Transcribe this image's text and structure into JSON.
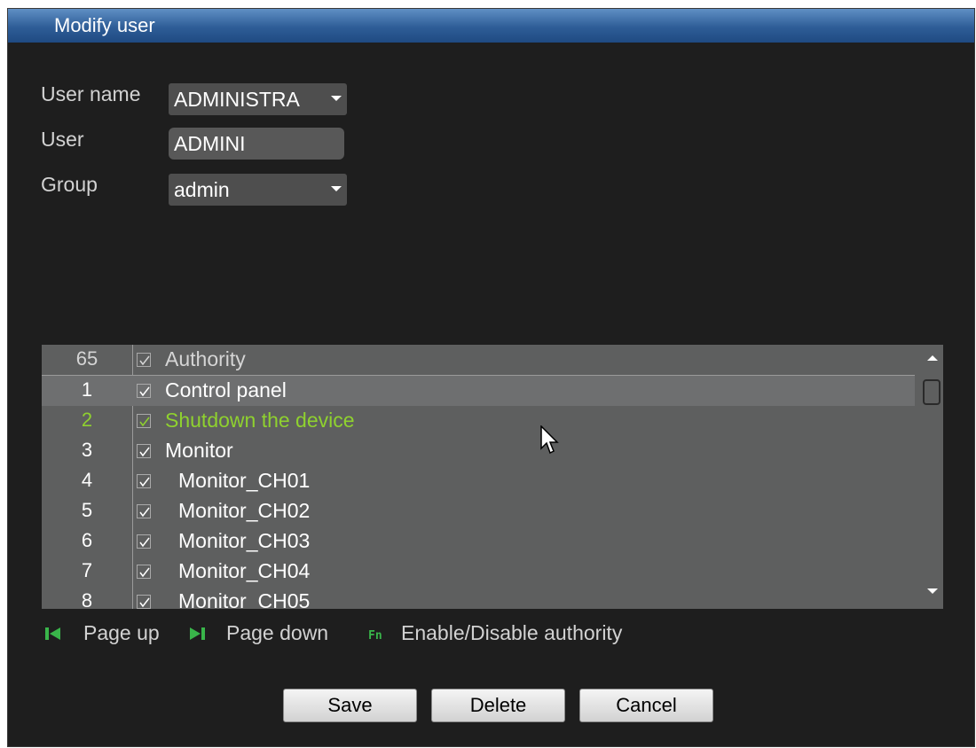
{
  "window": {
    "title": "Modify user"
  },
  "form": {
    "user_name_label": "User name",
    "user_name_value": "ADMINISTRA",
    "user_label": "User",
    "user_value": "ADMINI",
    "group_label": "Group",
    "group_value": "admin"
  },
  "authority_table": {
    "header": {
      "num": "65",
      "label": "Authority",
      "checked": true
    },
    "rows": [
      {
        "num": "1",
        "label": "Control panel",
        "checked": true,
        "selected": true
      },
      {
        "num": "2",
        "label": "Shutdown the device",
        "checked": true,
        "highlighted": true
      },
      {
        "num": "3",
        "label": "Monitor",
        "checked": true
      },
      {
        "num": "4",
        "label": "Monitor_CH01",
        "checked": true
      },
      {
        "num": "5",
        "label": "Monitor_CH02",
        "checked": true
      },
      {
        "num": "6",
        "label": "Monitor_CH03",
        "checked": true
      },
      {
        "num": "7",
        "label": "Monitor_CH04",
        "checked": true
      },
      {
        "num": "8",
        "label": "Monitor_CH05",
        "checked": true
      }
    ],
    "highlight_color": "#8fd12f"
  },
  "hints": {
    "page_up": "Page up",
    "page_down": "Page down",
    "fn_key": "Fn",
    "enable_disable": "Enable/Disable authority"
  },
  "buttons": {
    "save": "Save",
    "delete": "Delete",
    "cancel": "Cancel"
  },
  "colors": {
    "titlebar": "#2e5d97",
    "background": "#1e1e1e",
    "table": "#5e5f5f",
    "hint_icon": "#39b54a"
  }
}
